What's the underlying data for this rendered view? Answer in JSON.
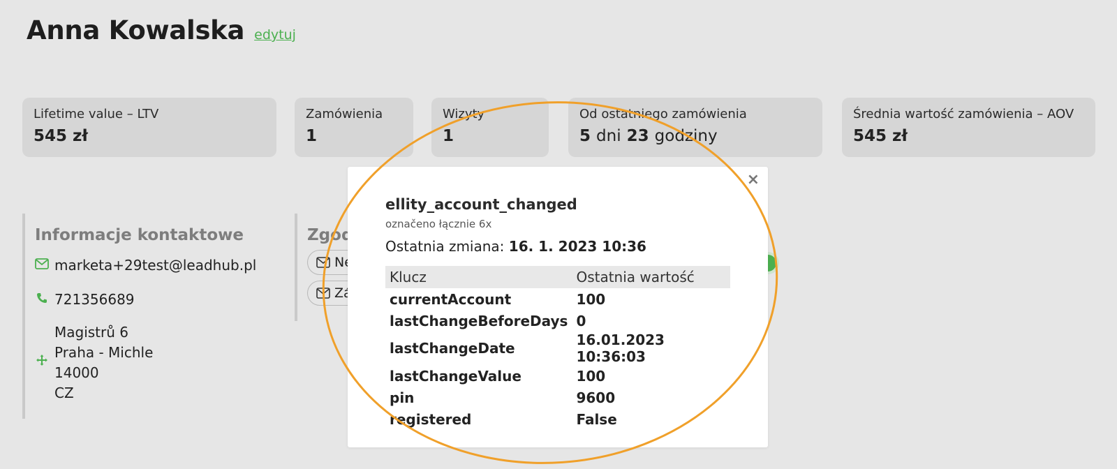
{
  "profile": {
    "name": "Anna Kowalska",
    "edit_label": "edytuj"
  },
  "stats": [
    {
      "label": "Lifetime value – LTV",
      "value": "545 zł"
    },
    {
      "label": "Zamówienia",
      "value": "1"
    },
    {
      "label": "Wizyty",
      "value": "1"
    },
    {
      "label": "Od ostatniego zamówienia",
      "days": "5",
      "days_unit": "dni",
      "hours": "23",
      "hours_unit": "godziny"
    },
    {
      "label": "Średnia wartość zamówienia – AOV",
      "value": "545 zł"
    }
  ],
  "contact": {
    "title": "Informacje kontaktowe",
    "email": "marketa+29test@leadhub.pl",
    "phone": "721356689",
    "address": [
      "Magistrů 6",
      "Praha - Michle",
      "14000",
      "CZ"
    ],
    "icons": [
      "mail-icon",
      "phone-icon",
      "location-icon"
    ]
  },
  "consent": {
    "title": "Zgody",
    "chips": [
      "Ne",
      "Zá"
    ]
  },
  "modal": {
    "close_label": "×",
    "event_name": "ellity_account_changed",
    "count_text": "označeno łącznie 6x",
    "last_change_label": "Ostatnia zmiana:",
    "last_change_value": "16. 1. 2023 10:36",
    "table": {
      "headers": [
        "Klucz",
        "Ostatnia wartość"
      ],
      "rows": [
        [
          "currentAccount",
          "100"
        ],
        [
          "lastChangeBeforeDays",
          "0"
        ],
        [
          "lastChangeDate",
          "16.01.2023 10:36:03"
        ],
        [
          "lastChangeValue",
          "100"
        ],
        [
          "pin",
          "9600"
        ],
        [
          "registered",
          "False"
        ]
      ]
    }
  },
  "colors": {
    "accent": "#4cb050",
    "highlight": "#f0a02a",
    "card_bg": "#d6d6d6",
    "page_bg": "#e6e6e6"
  }
}
